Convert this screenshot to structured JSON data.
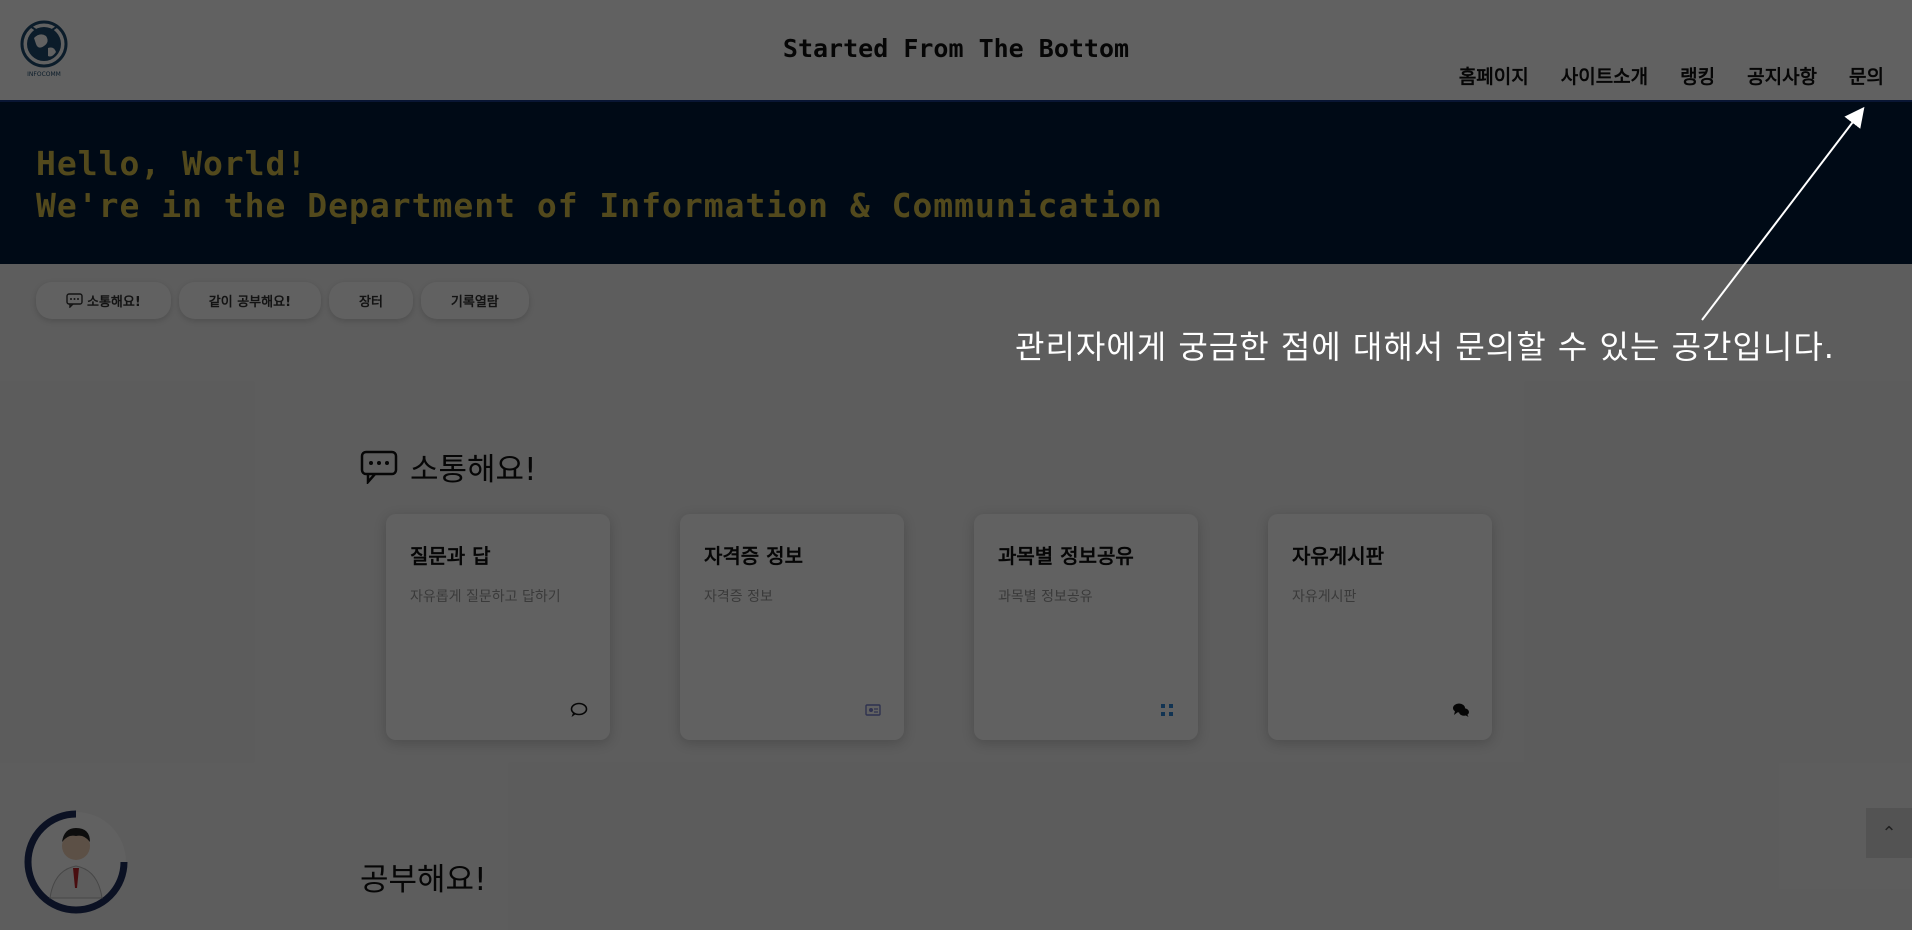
{
  "header": {
    "site_title": "Started From The Bottom",
    "logo_text": "INFOCOMM",
    "nav": [
      "홈페이지",
      "사이트소개",
      "랭킹",
      "공지사항",
      "문의"
    ]
  },
  "banner": {
    "line1": "Hello, World!",
    "line2": "We're in the Department of Information & Communication"
  },
  "tabs": [
    "소통해요!",
    "같이 공부해요!",
    "장터",
    "기록열람"
  ],
  "sections": {
    "communicate_title": "소통해요!",
    "study_title": "공부해요!"
  },
  "cards": [
    {
      "title": "질문과 답",
      "desc": "자유롭게 질문하고 답하기",
      "icon": "comment-icon"
    },
    {
      "title": "자격증 정보",
      "desc": "자격증 정보",
      "icon": "id-card-icon"
    },
    {
      "title": "과목별 정보공유",
      "desc": "과목별 정보공유",
      "icon": "grid-icon"
    },
    {
      "title": "자유게시판",
      "desc": "자유게시판",
      "icon": "comments-icon"
    }
  ],
  "scroll_top_icon": "chevron-up-icon",
  "tooltip": {
    "text": "관리자에게 궁금한 점에 대해서 문의할 수 있는 공간입니다."
  },
  "colors": {
    "banner_bg": "#001b3b",
    "banner_text": "#d8c04a",
    "header_border": "#1a3a8a"
  }
}
